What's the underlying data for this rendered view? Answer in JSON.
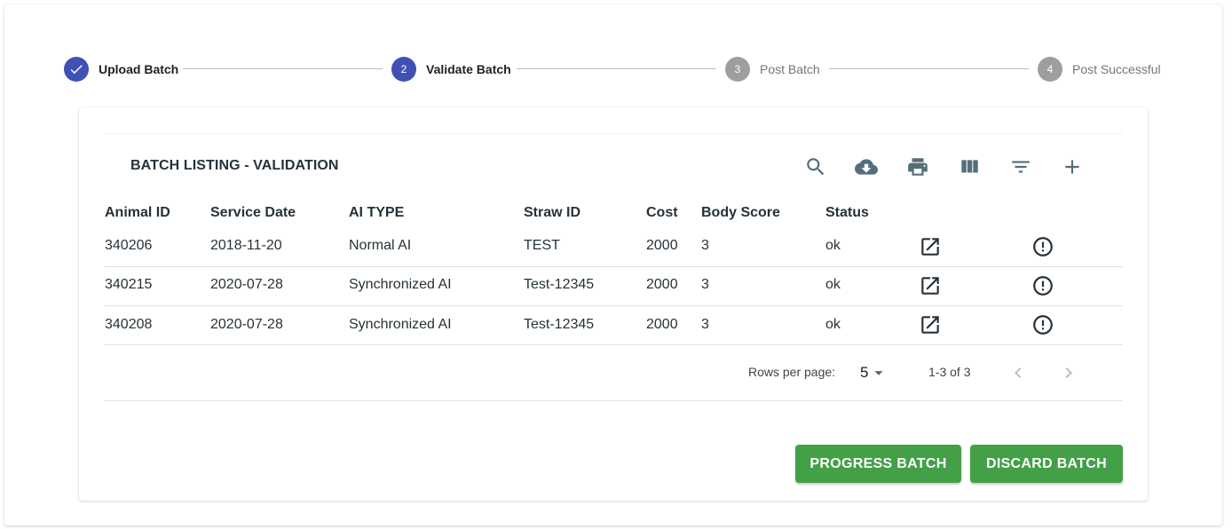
{
  "stepper": {
    "steps": [
      {
        "number": "",
        "label": "Upload Batch",
        "state": "completed"
      },
      {
        "number": "2",
        "label": "Validate Batch",
        "state": "active"
      },
      {
        "number": "3",
        "label": "Post Batch",
        "state": "pending"
      },
      {
        "number": "4",
        "label": "Post Successful",
        "state": "pending"
      }
    ]
  },
  "table": {
    "title": "BATCH LISTING - VALIDATION",
    "toolbar_icons": [
      "search-icon",
      "cloud-download-icon",
      "print-icon",
      "view-column-icon",
      "filter-list-icon",
      "add-icon"
    ],
    "columns": [
      "Animal ID",
      "Service Date",
      "AI TYPE",
      "Straw ID",
      "Cost",
      "Body Score",
      "Status"
    ],
    "rows": [
      [
        "340206",
        "2018-11-20",
        "Normal AI",
        "TEST",
        "2000",
        "3",
        "ok"
      ],
      [
        "340215",
        "2020-07-28",
        "Synchronized AI",
        "Test-12345",
        "2000",
        "3",
        "ok"
      ],
      [
        "340208",
        "2020-07-28",
        "Synchronized AI",
        "Test-12345",
        "2000",
        "3",
        "ok"
      ]
    ],
    "row_action_icons": [
      "open-in-new-icon",
      "error-outline-icon"
    ]
  },
  "pagination": {
    "rows_per_page_label": "Rows per page:",
    "rows_per_page_value": "5",
    "range": "1-3 of 3"
  },
  "actions": {
    "progress_label": "PROGRESS BATCH",
    "discard_label": "DISCARD BATCH"
  },
  "colors": {
    "step_active": "#3f51b5",
    "step_inactive": "#9e9e9e",
    "button_green": "#43a047",
    "icon_grey": "#546e7a"
  }
}
